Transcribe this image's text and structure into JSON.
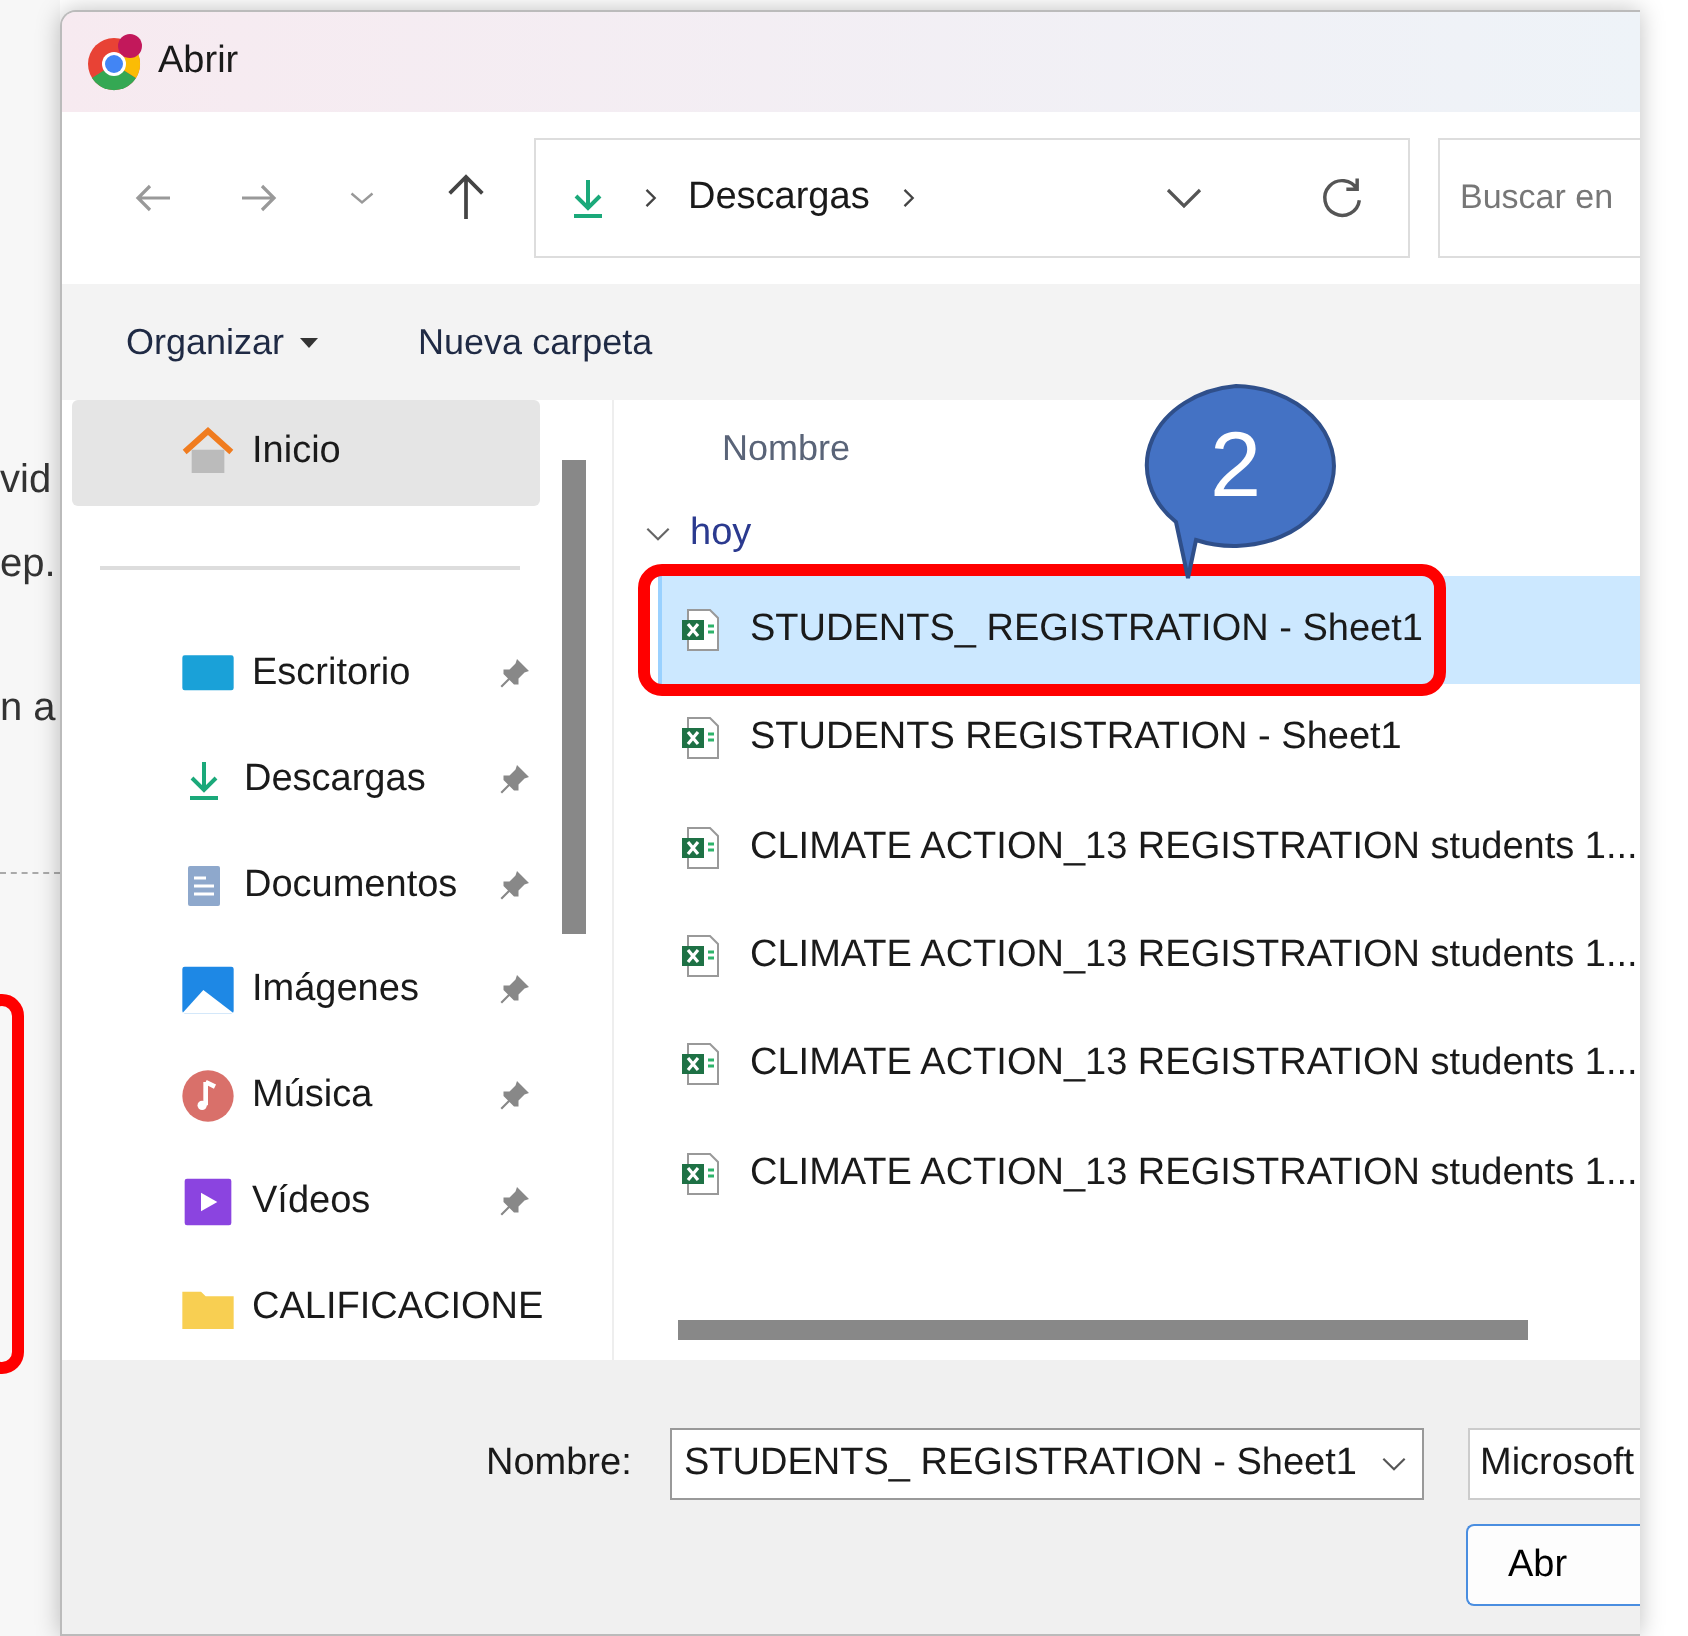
{
  "background": {
    "fragments": [
      "vid",
      "ep.",
      "n a"
    ]
  },
  "window": {
    "title": "Abrir"
  },
  "address": {
    "path": [
      "Descargas"
    ],
    "search_placeholder": "Buscar en"
  },
  "toolbar": {
    "organize": "Organizar",
    "new_folder": "Nueva carpeta"
  },
  "sidebar": {
    "items": [
      {
        "label": "Inicio",
        "kind": "home",
        "selected": true,
        "pinned": false
      },
      {
        "label": "Escritorio",
        "kind": "desktop",
        "selected": false,
        "pinned": true
      },
      {
        "label": "Descargas",
        "kind": "download",
        "selected": false,
        "pinned": true
      },
      {
        "label": "Documentos",
        "kind": "documents",
        "selected": false,
        "pinned": true
      },
      {
        "label": "Imágenes",
        "kind": "pictures",
        "selected": false,
        "pinned": true
      },
      {
        "label": "Música",
        "kind": "music",
        "selected": false,
        "pinned": true
      },
      {
        "label": "Vídeos",
        "kind": "videos",
        "selected": false,
        "pinned": true
      },
      {
        "label": "CALIFICACIONE",
        "kind": "folder",
        "selected": false,
        "pinned": false
      }
    ]
  },
  "files": {
    "column": "Nombre",
    "group": {
      "label": "hoy",
      "expanded": true
    },
    "rows": [
      {
        "name": "STUDENTS_ REGISTRATION - Sheet1",
        "selected": true,
        "highlighted": true
      },
      {
        "name": "STUDENTS REGISTRATION - Sheet1",
        "selected": false,
        "highlighted": false
      },
      {
        "name": "CLIMATE ACTION_13 REGISTRATION students 1...",
        "selected": false,
        "highlighted": false
      },
      {
        "name": "CLIMATE ACTION_13 REGISTRATION students 1...",
        "selected": false,
        "highlighted": false
      },
      {
        "name": "CLIMATE ACTION_13 REGISTRATION students 1...",
        "selected": false,
        "highlighted": false
      },
      {
        "name": "CLIMATE ACTION_13 REGISTRATION students 1...",
        "selected": false,
        "highlighted": false
      }
    ]
  },
  "footer": {
    "name_label": "Nombre:",
    "name_value": "STUDENTS_ REGISTRATION - Sheet1",
    "file_type": "Microsoft",
    "open_button": "Abr"
  },
  "callout": {
    "label": "2"
  }
}
